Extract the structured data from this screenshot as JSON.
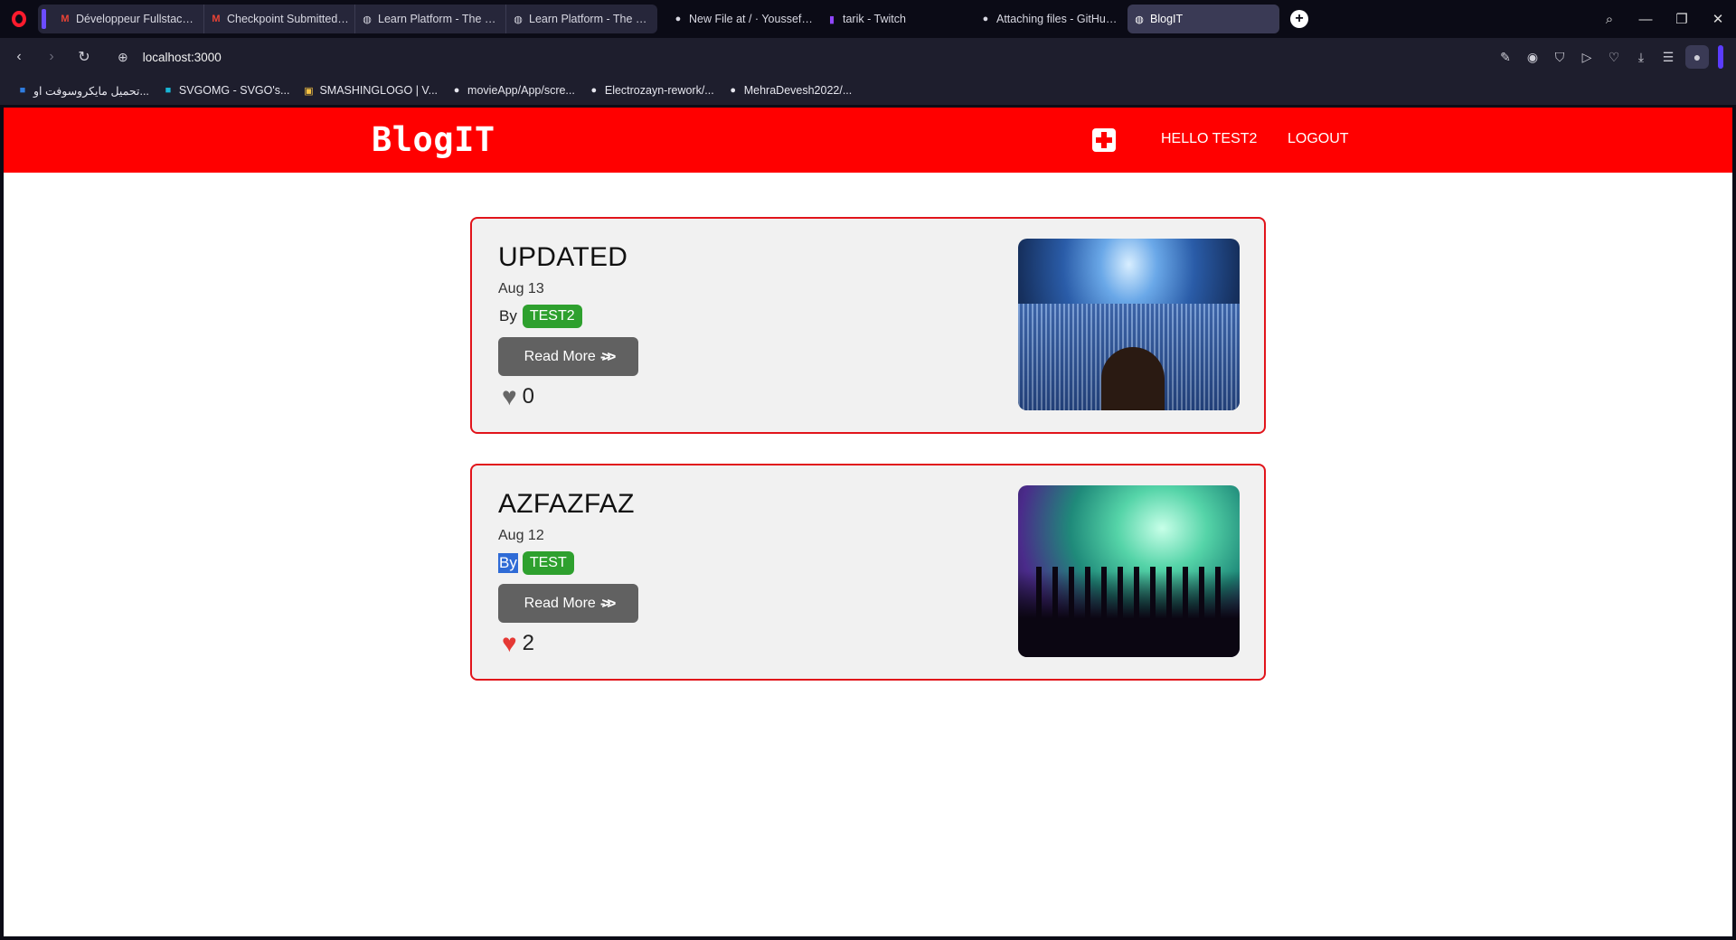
{
  "browser": {
    "tabs": [
      {
        "label": "Développeur Fullstack js - ",
        "icon": "gmail-icon"
      },
      {
        "label": "Checkpoint Submitted - G",
        "icon": "gmail-icon"
      },
      {
        "label": "Learn Platform - The GOM",
        "icon": "globe-icon"
      },
      {
        "label": "Learn Platform - The GOM",
        "icon": "globe-icon"
      },
      {
        "label": "New File at / · YoussefRs/",
        "icon": "github-icon"
      },
      {
        "label": "tarik - Twitch",
        "icon": "twitch-icon"
      },
      {
        "label": "Attaching files - GitHub D",
        "icon": "github-icon"
      },
      {
        "label": "BlogIT",
        "icon": "globe-icon"
      }
    ],
    "url": "localhost:3000",
    "bookmarks": [
      {
        "label": "تحميل مايكروسوفت او...",
        "icon": "windows-icon"
      },
      {
        "label": "SVGOMG - SVGO's...",
        "icon": "svgomg-icon"
      },
      {
        "label": "SMASHINGLOGO | V...",
        "icon": "smashinglogo-icon"
      },
      {
        "label": "movieApp/App/scre...",
        "icon": "github-icon"
      },
      {
        "label": "Electrozayn-rework/...",
        "icon": "github-icon"
      },
      {
        "label": "MehraDevesh2022/...",
        "icon": "github-icon"
      }
    ]
  },
  "app": {
    "brand": "BlogIT",
    "greeting": "HELLO TEST2",
    "logout": "LOGOUT"
  },
  "posts": [
    {
      "title": "UPDATED",
      "date": "Aug 13",
      "by": "By",
      "author": "TEST2",
      "read_more": "Read More",
      "likes": "0",
      "liked": false,
      "image": "concert-crowd"
    },
    {
      "title": "AZFAZFAZ",
      "date": "Aug 12",
      "by": "By",
      "author": "TEST",
      "read_more": "Read More",
      "likes": "2",
      "liked": true,
      "image": "smoke-crowd"
    }
  ],
  "colors": {
    "navbar": "#ff0000",
    "card_border": "#e1141b",
    "author_badge": "#2ea02e",
    "read_more_button": "#616161",
    "heart_liked": "#e53935",
    "heart_unliked": "#666666"
  }
}
